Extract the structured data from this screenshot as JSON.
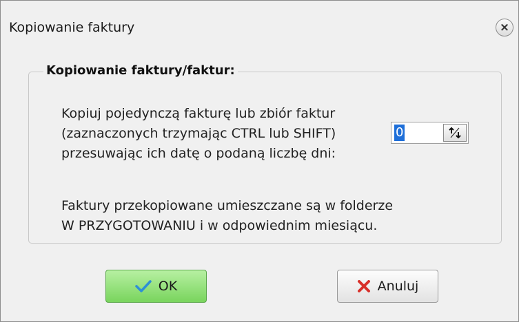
{
  "window": {
    "title": "Kopiowanie faktury",
    "close_glyph": "×",
    "close_icon": "close-icon"
  },
  "group": {
    "title": "Kopiowanie faktury/faktur:",
    "description_lines": [
      "Kopiuj pojedynczą fakturę lub zbiór faktur",
      "(zaznaczonych trzymając CTRL lub SHIFT)",
      "przesuwając ich datę o podaną liczbę dni:"
    ],
    "days_value": "0",
    "spin_icon": "up-down-arrows-icon",
    "note_lines": [
      "Faktury przekopiowane umieszczane są w folderze",
      "W PRZYGOTOWANIU i w odpowiednim miesiącu."
    ]
  },
  "buttons": {
    "ok_label": "OK",
    "ok_icon": "checkmark-icon",
    "cancel_label": "Anuluj",
    "cancel_icon": "x-icon"
  },
  "colors": {
    "ok_green": "#79d45d",
    "checkmark": "#2e8fd6",
    "cancel_red": "#d8302a",
    "selection_blue": "#1e6fd9"
  }
}
